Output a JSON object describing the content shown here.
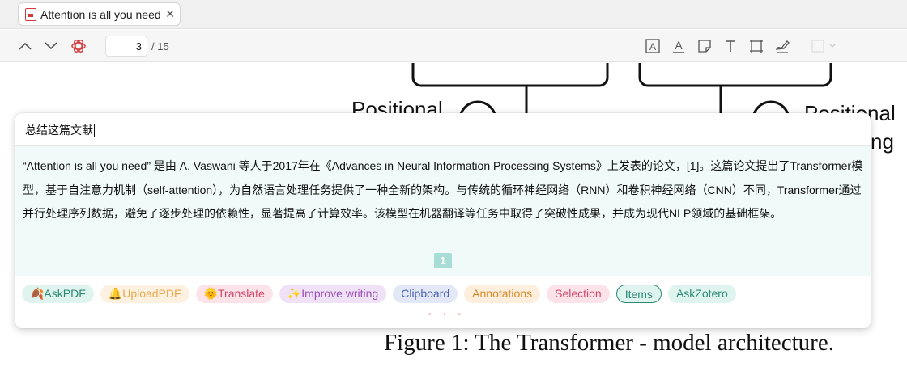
{
  "tab": {
    "title": "Attention is all you need",
    "close": "✕"
  },
  "toolbar": {
    "page_current": "3",
    "page_total": "/ 15"
  },
  "pdf": {
    "positional_left": "Positional",
    "positional_right": "Positional",
    "right_fragment": "ng",
    "caption": "Figure 1: The Transformer - model architecture."
  },
  "popup": {
    "query": "总结这篇文献",
    "answer": "“Attention is all you need” 是由 A. Vaswani 等人于2017年在《Advances in Neural Information Processing Systems》上发表的论文，[1]。这篇论文提出了Transformer模型，基于自注意力机制（self-attention），为自然语言处理任务提供了一种全新的架构。与传统的循环神经网络（RNN）和卷积神经网络（CNN）不同，Transformer通过并行处理序列数据，避免了逐步处理的依赖性，显著提高了计算效率。该模型在机器翻译等任务中取得了突破性成果，并成为现代NLP领域的基础框架。",
    "citation": "1",
    "pills": [
      {
        "label": "🍂AskPDF",
        "bg": "#dff3ef",
        "color": "#2c8a78",
        "border": "none"
      },
      {
        "label": "🔔UploadPDF",
        "bg": "#fdf1e2",
        "color": "#e9a94a",
        "border": "none"
      },
      {
        "label": "🌞Translate",
        "bg": "#fce3ea",
        "color": "#d04a6a",
        "border": "none"
      },
      {
        "label": "✨Improve writing",
        "bg": "#efe2f6",
        "color": "#9a4fb6",
        "border": "none"
      },
      {
        "label": "Clipboard",
        "bg": "#e3e8f6",
        "color": "#4d62b2",
        "border": "none"
      },
      {
        "label": "Annotations",
        "bg": "#fdeedd",
        "color": "#d98a26",
        "border": "none"
      },
      {
        "label": "Selection",
        "bg": "#fce3ea",
        "color": "#d04a6a",
        "border": "none"
      },
      {
        "label": "Items",
        "bg": "#dff3ef",
        "color": "#2c8a78",
        "border": "1px solid #2c8a78"
      },
      {
        "label": "AskZotero",
        "bg": "#dff3ef",
        "color": "#2c8a78",
        "border": "none"
      }
    ],
    "more": "• • •"
  },
  "icons": {
    "up": "chevron-up-icon",
    "down": "chevron-down-icon",
    "gpt": "openai-icon",
    "tools": [
      "text-box-icon",
      "underline-text-icon",
      "note-icon",
      "text-icon",
      "area-select-icon",
      "signature-icon",
      "color-picker-icon"
    ]
  }
}
